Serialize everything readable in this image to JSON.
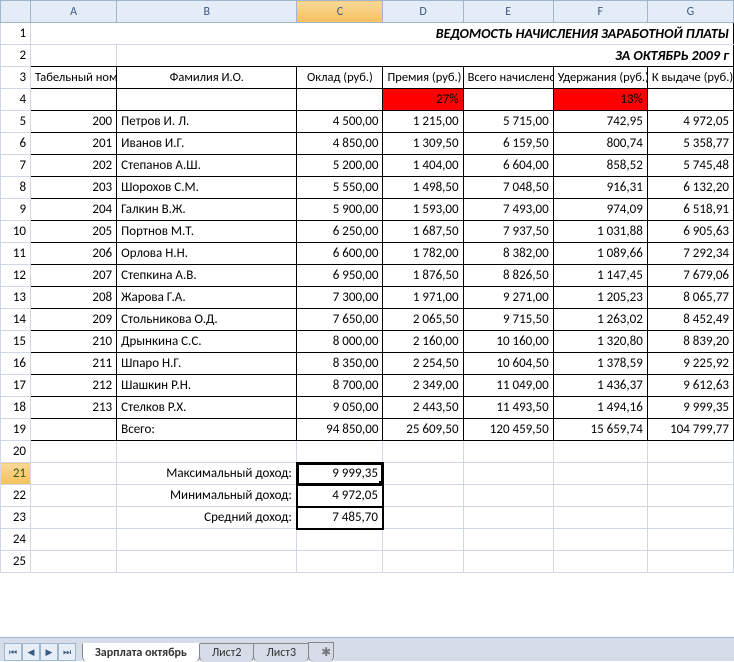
{
  "sheet": {
    "cols": [
      "A",
      "B",
      "C",
      "D",
      "E",
      "F",
      "G"
    ],
    "row_labels": [
      "1",
      "2",
      "3",
      "4",
      "5",
      "6",
      "7",
      "8",
      "9",
      "10",
      "11",
      "12",
      "13",
      "14",
      "15",
      "16",
      "17",
      "18",
      "19",
      "20",
      "21",
      "22",
      "23",
      "24",
      "25"
    ],
    "title": "ВЕДОМОСТЬ НАЧИСЛЕНИЯ ЗАРАБОТНОЙ ПЛАТЫ",
    "subtitle": "ЗА ОКТЯБРЬ 2009 г",
    "headers": {
      "tab_num": "Табельный номер",
      "fio": "Фамилия И.О.",
      "salary": "Оклад (руб.)",
      "bonus": "Премия (руб.)",
      "accrued": "Всего начислено (руб.)",
      "withheld": "Удержания (руб.)",
      "payout": "К выдаче (руб.)"
    },
    "percents": {
      "bonus": "27%",
      "withheld": "13%"
    },
    "rows": [
      {
        "num": "200",
        "fio": "Петров И. Л.",
        "salary": "4 500,00",
        "bonus": "1 215,00",
        "accrued": "5 715,00",
        "withheld": "742,95",
        "payout": "4 972,05"
      },
      {
        "num": "201",
        "fio": "Иванов И.Г.",
        "salary": "4 850,00",
        "bonus": "1 309,50",
        "accrued": "6 159,50",
        "withheld": "800,74",
        "payout": "5 358,77"
      },
      {
        "num": "202",
        "fio": "Степанов А.Ш.",
        "salary": "5 200,00",
        "bonus": "1 404,00",
        "accrued": "6 604,00",
        "withheld": "858,52",
        "payout": "5 745,48"
      },
      {
        "num": "203",
        "fio": "Шорохов С.М.",
        "salary": "5 550,00",
        "bonus": "1 498,50",
        "accrued": "7 048,50",
        "withheld": "916,31",
        "payout": "6 132,20"
      },
      {
        "num": "204",
        "fio": "Галкин В.Ж.",
        "salary": "5 900,00",
        "bonus": "1 593,00",
        "accrued": "7 493,00",
        "withheld": "974,09",
        "payout": "6 518,91"
      },
      {
        "num": "205",
        "fio": "Портнов М.Т.",
        "salary": "6 250,00",
        "bonus": "1 687,50",
        "accrued": "7 937,50",
        "withheld": "1 031,88",
        "payout": "6 905,63"
      },
      {
        "num": "206",
        "fio": "Орлова Н.Н.",
        "salary": "6 600,00",
        "bonus": "1 782,00",
        "accrued": "8 382,00",
        "withheld": "1 089,66",
        "payout": "7 292,34"
      },
      {
        "num": "207",
        "fio": "Степкина А.В.",
        "salary": "6 950,00",
        "bonus": "1 876,50",
        "accrued": "8 826,50",
        "withheld": "1 147,45",
        "payout": "7 679,06"
      },
      {
        "num": "208",
        "fio": "Жарова Г.А.",
        "salary": "7 300,00",
        "bonus": "1 971,00",
        "accrued": "9 271,00",
        "withheld": "1 205,23",
        "payout": "8 065,77"
      },
      {
        "num": "209",
        "fio": "Стольникова О.Д.",
        "salary": "7 650,00",
        "bonus": "2 065,50",
        "accrued": "9 715,50",
        "withheld": "1 263,02",
        "payout": "8 452,49"
      },
      {
        "num": "210",
        "fio": "Дрынкина С.С.",
        "salary": "8 000,00",
        "bonus": "2 160,00",
        "accrued": "10 160,00",
        "withheld": "1 320,80",
        "payout": "8 839,20"
      },
      {
        "num": "211",
        "fio": "Шпаро Н.Г.",
        "salary": "8 350,00",
        "bonus": "2 254,50",
        "accrued": "10 604,50",
        "withheld": "1 378,59",
        "payout": "9 225,92"
      },
      {
        "num": "212",
        "fio": "Шашкин Р.Н.",
        "salary": "8 700,00",
        "bonus": "2 349,00",
        "accrued": "11 049,00",
        "withheld": "1 436,37",
        "payout": "9 612,63"
      },
      {
        "num": "213",
        "fio": "Стелков Р.Х.",
        "salary": "9 050,00",
        "bonus": "2 443,50",
        "accrued": "11 493,50",
        "withheld": "1 494,16",
        "payout": "9 999,35"
      }
    ],
    "totals": {
      "label": "Всего:",
      "salary": "94 850,00",
      "bonus": "25 609,50",
      "accrued": "120 459,50",
      "withheld": "15 659,74",
      "payout": "104 799,77"
    },
    "summary": {
      "max_label": "Максимальный доход:",
      "max": "9 999,35",
      "min_label": "Минимальный доход:",
      "min": "4 972,05",
      "avg_label": "Средний доход:",
      "avg": "7 485,70"
    }
  },
  "tabs": {
    "active": "Зарплата октябрь",
    "others": [
      "Лист2",
      "Лист3"
    ]
  },
  "nav_glyphs": {
    "first": "⏮",
    "prev": "◀",
    "next": "▶",
    "last": "⏭",
    "insert": "✱"
  }
}
